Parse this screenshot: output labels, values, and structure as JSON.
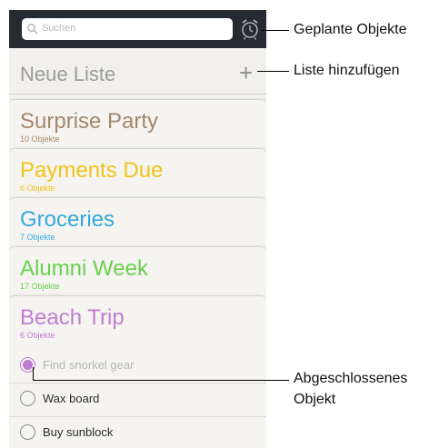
{
  "search": {
    "placeholder": "Suchen"
  },
  "new_list": {
    "title": "Neue Liste",
    "plus": "+"
  },
  "lists": [
    {
      "name": "Surprise Party",
      "count": "10 Objekte",
      "color": "#a4876b"
    },
    {
      "name": "Payments Due",
      "count": "6 Objekte",
      "color": "#f0c419"
    },
    {
      "name": "Groceries",
      "count": "7 Objekte",
      "color": "#36a8db"
    },
    {
      "name": "Alumni Week",
      "count": "17 Objekte",
      "color": "#69d050"
    },
    {
      "name": "Beach Trip",
      "count": "6 Objekte",
      "color": "#c07cd1"
    }
  ],
  "items": [
    {
      "label": "Find snorkel gear",
      "completed": true
    },
    {
      "label": "Wax board",
      "completed": false
    },
    {
      "label": "Buy sunblock",
      "completed": false
    }
  ],
  "callouts": {
    "scheduled": "Geplante Objekte",
    "add_list": "Liste hinzufügen",
    "completed_line1": "Abgeschlossenes",
    "completed_line2": "Objekt"
  },
  "icons": {
    "search": "search-icon",
    "alarm": "alarm-clock-icon",
    "add": "plus-icon"
  }
}
